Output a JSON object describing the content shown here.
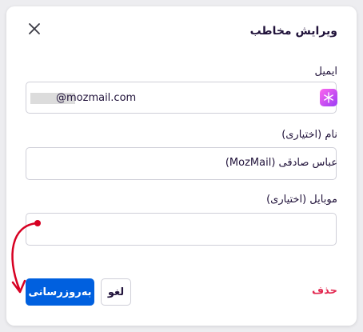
{
  "dialog": {
    "title": "ویرایش مخاطب",
    "close_icon": "close-icon"
  },
  "form": {
    "email": {
      "label": "ایمیل",
      "value": "@mozmail.com",
      "icon": "mask-icon"
    },
    "name": {
      "label": "نام (اختیاری)",
      "value": "عباس صادقی (MozMail)"
    },
    "mobile": {
      "label": "موبایل (اختیاری)",
      "value": ""
    }
  },
  "actions": {
    "delete_label": "حذف",
    "cancel_label": "لغو",
    "update_label": "به‌روزرسانی"
  },
  "colors": {
    "primary": "#0060df",
    "danger": "#e22850",
    "annotation": "#d70022"
  }
}
